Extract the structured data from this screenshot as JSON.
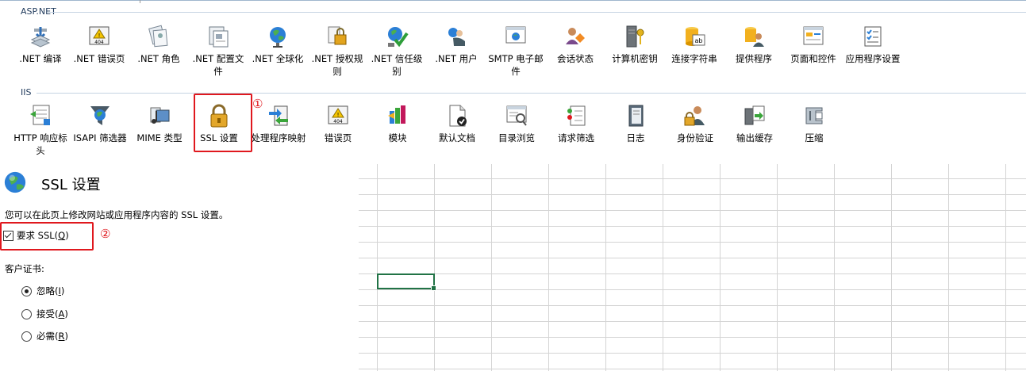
{
  "aspnet": {
    "header": "ASP.NET",
    "items": [
      {
        "label": ".NET 编译",
        "icon": "compile-icon"
      },
      {
        "label": ".NET 错误页",
        "icon": "error-404-icon"
      },
      {
        "label": ".NET 角色",
        "icon": "roles-icon"
      },
      {
        "label": ".NET 配置文件",
        "icon": "profile-icon"
      },
      {
        "label": ".NET 全球化",
        "icon": "globe-icon"
      },
      {
        "label": ".NET 授权规则",
        "icon": "authorization-lock-icon"
      },
      {
        "label": ".NET 信任级别",
        "icon": "trust-level-icon"
      },
      {
        "label": ".NET 用户",
        "icon": "users-icon"
      },
      {
        "label": "SMTP 电子邮件",
        "icon": "smtp-email-icon"
      },
      {
        "label": "会话状态",
        "icon": "session-state-icon"
      },
      {
        "label": "计算机密钥",
        "icon": "machine-key-icon"
      },
      {
        "label": "连接字符串",
        "icon": "connection-string-icon"
      },
      {
        "label": "提供程序",
        "icon": "providers-icon"
      },
      {
        "label": "页面和控件",
        "icon": "pages-controls-icon"
      },
      {
        "label": "应用程序设置",
        "icon": "app-settings-icon"
      }
    ]
  },
  "iis": {
    "header": "IIS",
    "items": [
      {
        "label": "HTTP 响应标头",
        "icon": "http-headers-icon"
      },
      {
        "label": "ISAPI 筛选器",
        "icon": "isapi-filter-icon"
      },
      {
        "label": "MIME 类型",
        "icon": "mime-types-icon"
      },
      {
        "label": "SSL 设置",
        "icon": "ssl-lock-icon"
      },
      {
        "label": "处理程序映射",
        "icon": "handler-mappings-icon"
      },
      {
        "label": "错误页",
        "icon": "error-pages-icon"
      },
      {
        "label": "模块",
        "icon": "modules-icon"
      },
      {
        "label": "默认文档",
        "icon": "default-document-icon"
      },
      {
        "label": "目录浏览",
        "icon": "directory-browsing-icon"
      },
      {
        "label": "请求筛选",
        "icon": "request-filtering-icon"
      },
      {
        "label": "日志",
        "icon": "logging-icon"
      },
      {
        "label": "身份验证",
        "icon": "authentication-icon"
      },
      {
        "label": "输出缓存",
        "icon": "output-caching-icon"
      },
      {
        "label": "压缩",
        "icon": "compression-icon"
      }
    ]
  },
  "annotations": {
    "one": "①",
    "two": "②"
  },
  "ssl": {
    "title": "SSL 设置",
    "description": "您可以在此页上修改网站或应用程序内容的 SSL 设置。",
    "require_ssl_label": "要求 SSL(",
    "require_ssl_key": "Q",
    "require_ssl_close": ")",
    "require_ssl_checked": true,
    "client_cert_label": "客户证书:",
    "options": [
      {
        "label": "忽略(",
        "key": "I",
        "close": ")",
        "selected": true
      },
      {
        "label": "接受(",
        "key": "A",
        "close": ")",
        "selected": false
      },
      {
        "label": "必需(",
        "key": "R",
        "close": ")",
        "selected": false
      }
    ]
  },
  "colors": {
    "highlight": "#e0181e",
    "header": "#1e395b",
    "selection": "#217346"
  }
}
